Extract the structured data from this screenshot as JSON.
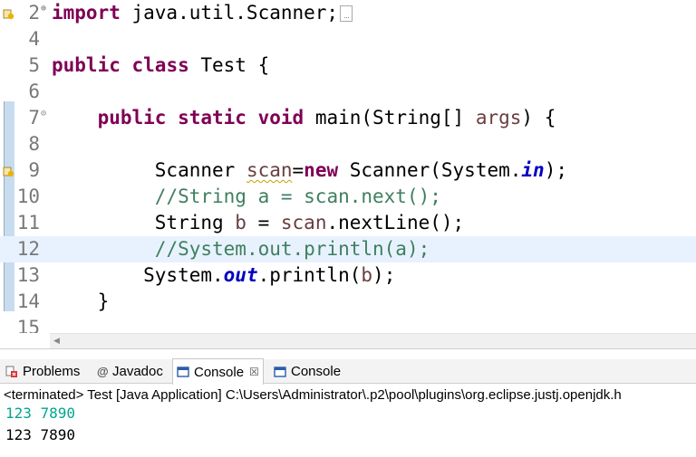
{
  "editor": {
    "lines": [
      {
        "num": "2",
        "fold": "⊕",
        "warning": true,
        "tokens": [
          {
            "t": "import",
            "c": "kw"
          },
          {
            "t": " java.util.Scanner;",
            "c": ""
          }
        ],
        "folded": true
      },
      {
        "num": "4",
        "tokens": []
      },
      {
        "num": "5",
        "tokens": [
          {
            "t": "public",
            "c": "kw"
          },
          {
            "t": " ",
            "c": ""
          },
          {
            "t": "class",
            "c": "kw"
          },
          {
            "t": " Test {",
            "c": ""
          }
        ]
      },
      {
        "num": "6",
        "tokens": []
      },
      {
        "num": "7",
        "fold": "⊝",
        "tokens": [
          {
            "t": "    ",
            "c": ""
          },
          {
            "t": "public",
            "c": "kw"
          },
          {
            "t": " ",
            "c": ""
          },
          {
            "t": "static",
            "c": "kw"
          },
          {
            "t": " ",
            "c": ""
          },
          {
            "t": "void",
            "c": "kw"
          },
          {
            "t": " main(String[] ",
            "c": ""
          },
          {
            "t": "args",
            "c": "var"
          },
          {
            "t": ") {",
            "c": ""
          }
        ]
      },
      {
        "num": "8",
        "tokens": []
      },
      {
        "num": "9",
        "warning": true,
        "tokens": [
          {
            "t": "         Scanner ",
            "c": ""
          },
          {
            "t": "scan",
            "c": "var warn-ul"
          },
          {
            "t": "=",
            "c": ""
          },
          {
            "t": "new",
            "c": "kw"
          },
          {
            "t": " Scanner(System.",
            "c": ""
          },
          {
            "t": "in",
            "c": "fld"
          },
          {
            "t": ");",
            "c": ""
          }
        ]
      },
      {
        "num": "10",
        "tokens": [
          {
            "t": "         ",
            "c": ""
          },
          {
            "t": "//String a = scan.next();",
            "c": "cm"
          }
        ]
      },
      {
        "num": "11",
        "tokens": [
          {
            "t": "         String ",
            "c": ""
          },
          {
            "t": "b",
            "c": "var"
          },
          {
            "t": " = ",
            "c": ""
          },
          {
            "t": "scan",
            "c": "var"
          },
          {
            "t": ".nextLine();",
            "c": ""
          }
        ]
      },
      {
        "num": "12",
        "current": true,
        "tokens": [
          {
            "t": "         ",
            "c": ""
          },
          {
            "t": "//System.out.println(a);",
            "c": "cm"
          }
        ]
      },
      {
        "num": "13",
        "tokens": [
          {
            "t": "        System.",
            "c": ""
          },
          {
            "t": "out",
            "c": "fld"
          },
          {
            "t": ".println(",
            "c": ""
          },
          {
            "t": "b",
            "c": "var"
          },
          {
            "t": ");",
            "c": ""
          }
        ]
      },
      {
        "num": "14",
        "tokens": [
          {
            "t": "    }",
            "c": ""
          }
        ]
      },
      {
        "num": "15",
        "tokens": []
      }
    ]
  },
  "panel": {
    "tabs": [
      {
        "label": "Problems",
        "icon": "problems-icon"
      },
      {
        "label": "Javadoc",
        "icon": "at-icon"
      },
      {
        "label": "Console",
        "icon": "console-icon",
        "active": true,
        "close": "☒"
      },
      {
        "label": "Console",
        "icon": "console-icon"
      }
    ],
    "status": "<terminated> Test [Java Application] C:\\Users\\Administrator\\.p2\\pool\\plugins\\org.eclipse.justj.openjdk.h",
    "output_input": "123 7890",
    "output_print": "123 7890"
  },
  "colors": {
    "keyword": "#7f0055",
    "comment": "#3f7f5f",
    "field": "#0000c0",
    "stdin": "#00a68f",
    "current_line": "#e8f2fe"
  }
}
